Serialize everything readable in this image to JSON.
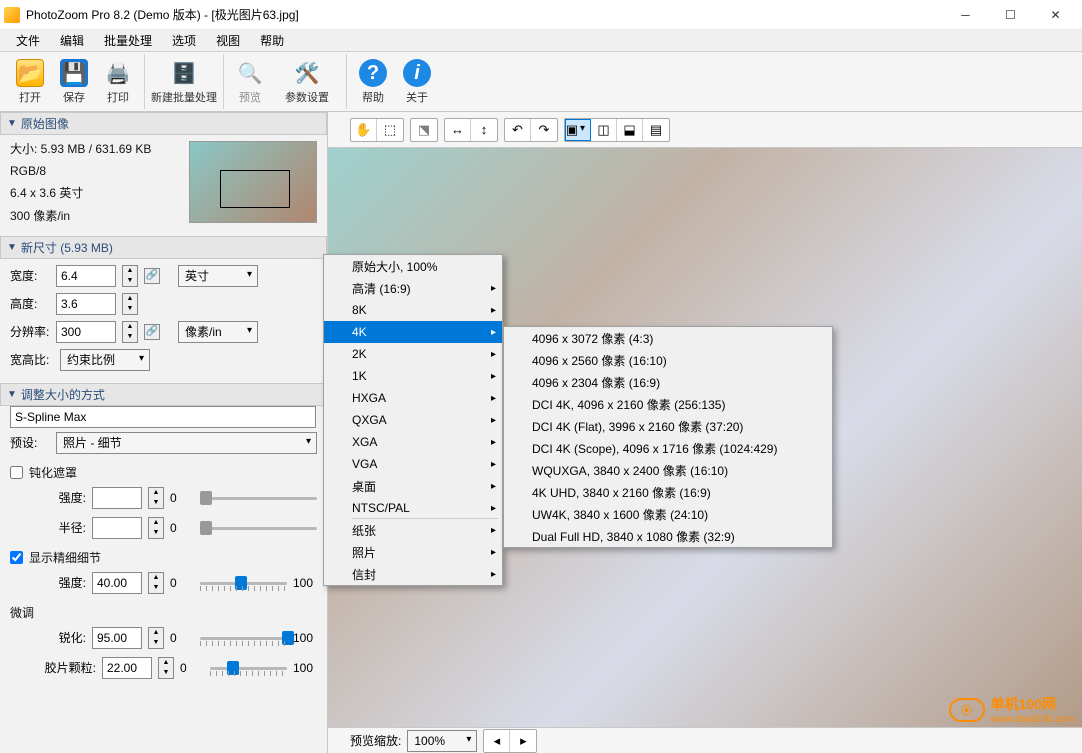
{
  "window": {
    "title": "PhotoZoom Pro 8.2 (Demo 版本) - [极光图片63.jpg]"
  },
  "menu": [
    "文件",
    "编辑",
    "批量处理",
    "选项",
    "视图",
    "帮助"
  ],
  "toolbar": {
    "open": "打开",
    "save": "保存",
    "print": "打印",
    "batch": "新建批量处理",
    "preview": "预览",
    "params": "参数设置",
    "help": "帮助",
    "about": "关于"
  },
  "panels": {
    "original": {
      "title": "原始图像",
      "size": "大小: 5.93 MB / 631.69 KB",
      "mode": "RGB/8",
      "dim": "6.4 x 3.6 英寸",
      "res": "300 像素/in"
    },
    "newsize": {
      "title": "新尺寸 (5.93 MB)",
      "width_lbl": "宽度:",
      "width": "6.4",
      "height_lbl": "高度:",
      "height": "3.6",
      "res_lbl": "分辨率:",
      "res": "300",
      "unit_dim": "英寸",
      "unit_res": "像素/in",
      "ratio_lbl": "宽高比:",
      "ratio_val": "约束比例"
    },
    "resize": {
      "title": "调整大小的方式",
      "method": "S-Spline Max",
      "preset_lbl": "预设:",
      "preset": "照片 - 细节",
      "sharpenmask": "钝化遮罩",
      "intensity_lbl": "强度:",
      "radius_lbl": "半径:",
      "finedetail": "显示精细细节",
      "intensity2": "40.00",
      "tweak": "微调",
      "sharp_lbl": "锐化:",
      "sharp": "95.00",
      "grain_lbl": "胶片颗粒:",
      "grain": "22.00",
      "zero": "0",
      "hundred": "100"
    }
  },
  "ctx1": [
    "原始大小, 100%",
    "高清 (16:9)",
    "8K",
    "4K",
    "2K",
    "1K",
    "HXGA",
    "QXGA",
    "XGA",
    "VGA",
    "桌面",
    "NTSC/PAL",
    "纸张",
    "照片",
    "信封"
  ],
  "ctx2": [
    "4096 x 3072 像素 (4:3)",
    "4096 x 2560 像素 (16:10)",
    "4096 x 2304 像素 (16:9)",
    "DCI 4K, 4096 x 2160 像素 (256:135)",
    "DCI 4K (Flat), 3996 x 2160 像素 (37:20)",
    "DCI 4K (Scope), 4096 x 1716 像素 (1024:429)",
    "WQUXGA, 3840 x 2400 像素 (16:10)",
    "4K UHD, 3840 x 2160 像素 (16:9)",
    "UW4K, 3840 x 1600 像素 (24:10)",
    "Dual Full HD, 3840 x 1080 像素 (32:9)"
  ],
  "bottom": {
    "label": "预览缩放:",
    "zoom": "100%"
  },
  "watermark": {
    "brand": "单机100网",
    "url": "www.danji100.com"
  }
}
